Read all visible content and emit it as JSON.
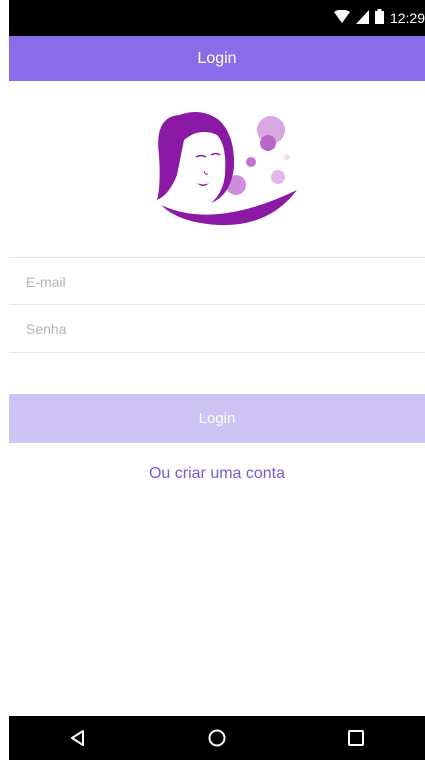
{
  "status_bar": {
    "time": "12:29",
    "icons": [
      "wifi-icon",
      "cell-signal-icon",
      "battery-icon"
    ]
  },
  "app_bar": {
    "title": "Login"
  },
  "form": {
    "email_placeholder": "E-mail",
    "password_placeholder": "Senha",
    "login_label": "Login",
    "create_account_label": "Ou criar uma conta"
  },
  "nav_bar": {
    "icons": [
      "back-icon",
      "home-icon",
      "recents-icon"
    ]
  },
  "colors": {
    "app_bar": "#8b6ce8",
    "login_button": "#cec3f5",
    "link": "#7a5bd6",
    "logo_primary": "#8a1aa5",
    "logo_bubble": "#c98ad6"
  }
}
